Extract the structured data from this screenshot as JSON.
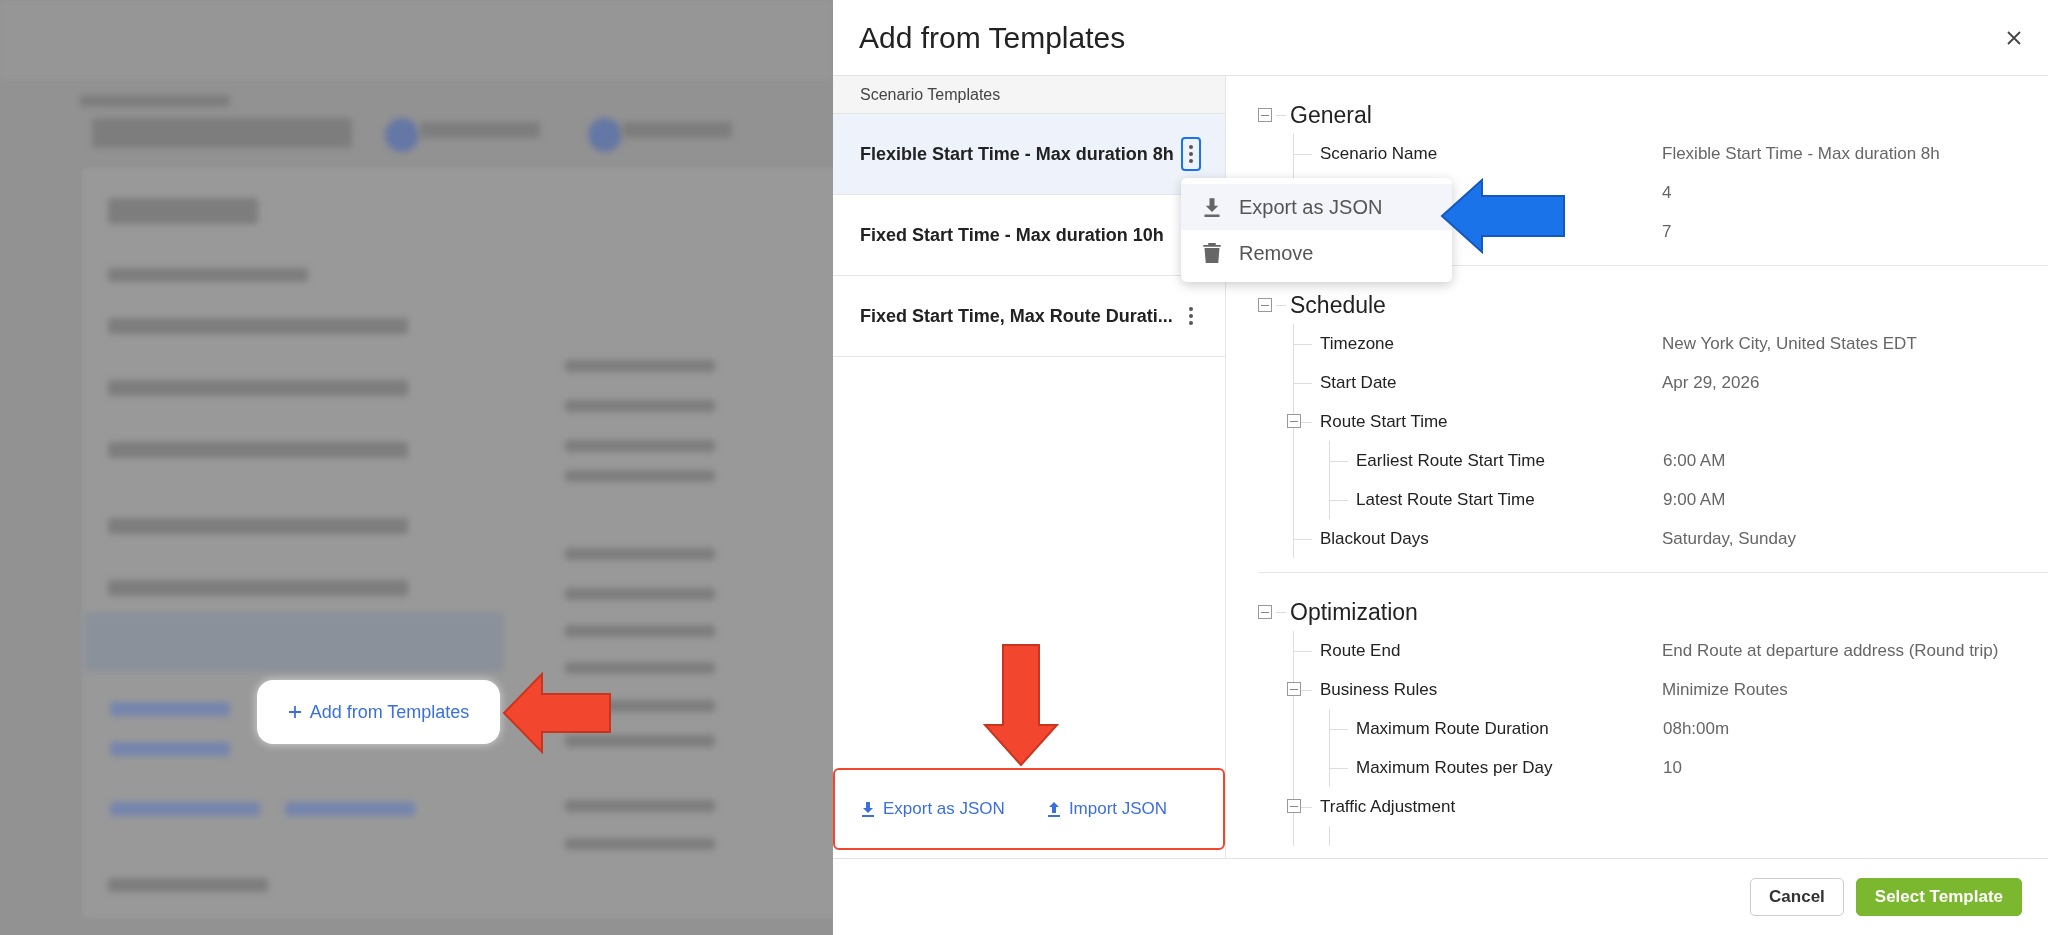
{
  "background": {
    "highlighted_button": {
      "label": "Add from Templates"
    }
  },
  "dialog": {
    "title": "Add from Templates",
    "templates": {
      "header": "Scenario Templates",
      "items": [
        {
          "name": "Flexible Start Time - Max duration 8h",
          "selected": true,
          "menu_open": true
        },
        {
          "name": "Fixed Start Time - Max duration 10h",
          "selected": false
        },
        {
          "name": "Fixed Start Time, Max Route Durati...",
          "selected": false,
          "menu_open": false
        }
      ],
      "actions": [
        {
          "label": "Export as JSON",
          "kind": "download"
        },
        {
          "label": "Import JSON",
          "kind": "upload"
        }
      ]
    },
    "menu": [
      {
        "label": "Export as JSON",
        "kind": "download",
        "hovered": true
      },
      {
        "label": "Remove",
        "kind": "trash",
        "hovered": false
      }
    ],
    "details": [
      {
        "title": "General",
        "expanded": true,
        "items": [
          {
            "label": "Scenario Name",
            "value": "Flexible Start Time - Max duration 8h"
          },
          {
            "value": "4"
          },
          {
            "value": "7"
          }
        ]
      },
      {
        "title": "Schedule",
        "expanded": true,
        "items": [
          {
            "label": "Timezone",
            "value": "New York City, United States EDT"
          },
          {
            "label": "Start Date",
            "value": "Apr 29, 2026"
          },
          {
            "label": "Route Start Time",
            "expanded": true,
            "children": [
              {
                "label": "Earliest Route Start Time",
                "value": "6:00 AM"
              },
              {
                "label": "Latest Route Start Time",
                "value": "9:00 AM"
              }
            ]
          },
          {
            "label": "Blackout Days",
            "value": "Saturday, Sunday"
          }
        ]
      },
      {
        "title": "Optimization",
        "expanded": true,
        "items": [
          {
            "label": "Route End",
            "value": "End Route at departure address (Round trip)"
          },
          {
            "label": "Business Rules",
            "value": "Minimize Routes",
            "expanded": true,
            "children": [
              {
                "label": "Maximum Route Duration",
                "value": "08h:00m"
              },
              {
                "label": "Maximum Routes per Day",
                "value": "10"
              }
            ]
          },
          {
            "label": "Traffic Adjustment",
            "expanded": true
          }
        ]
      }
    ],
    "buttons": [
      {
        "label": "Cancel",
        "kind": "secondary"
      },
      {
        "label": "Select Template",
        "kind": "primary"
      }
    ]
  }
}
